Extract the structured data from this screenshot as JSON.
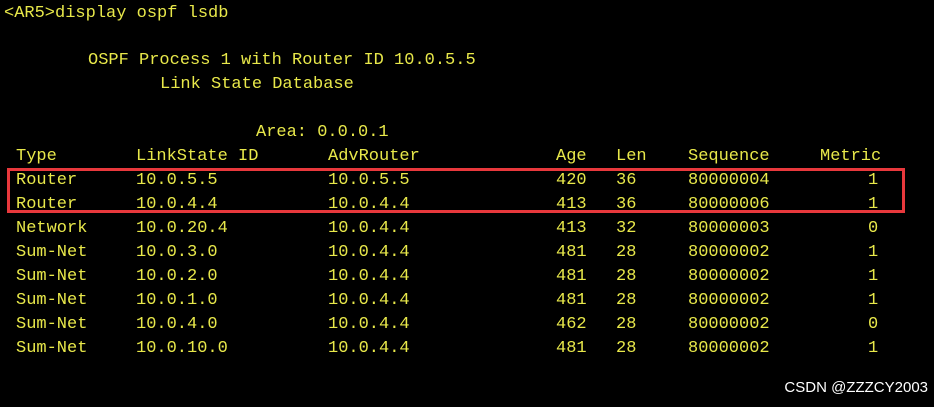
{
  "terminal": {
    "command_line": "<AR5>display ospf lsdb",
    "process_line": "OSPF Process 1 with Router ID 10.0.5.5",
    "database_title": "Link State Database",
    "area_line": "Area: 0.0.0.1",
    "columns": {
      "type": "Type",
      "linkstate_id": "LinkState ID",
      "adv_router": "AdvRouter",
      "age": "Age",
      "len": "Len",
      "sequence": "Sequence",
      "metric": "Metric"
    },
    "rows": [
      {
        "type": "Router",
        "linkstate_id": "10.0.5.5",
        "adv_router": "10.0.5.5",
        "age": "420",
        "len": "36",
        "sequence": "80000004",
        "metric": "1"
      },
      {
        "type": "Router",
        "linkstate_id": "10.0.4.4",
        "adv_router": "10.0.4.4",
        "age": "413",
        "len": "36",
        "sequence": "80000006",
        "metric": "1"
      },
      {
        "type": "Network",
        "linkstate_id": "10.0.20.4",
        "adv_router": "10.0.4.4",
        "age": "413",
        "len": "32",
        "sequence": "80000003",
        "metric": "0"
      },
      {
        "type": "Sum-Net",
        "linkstate_id": "10.0.3.0",
        "adv_router": "10.0.4.4",
        "age": "481",
        "len": "28",
        "sequence": "80000002",
        "metric": "1"
      },
      {
        "type": "Sum-Net",
        "linkstate_id": "10.0.2.0",
        "adv_router": "10.0.4.4",
        "age": "481",
        "len": "28",
        "sequence": "80000002",
        "metric": "1"
      },
      {
        "type": "Sum-Net",
        "linkstate_id": "10.0.1.0",
        "adv_router": "10.0.4.4",
        "age": "481",
        "len": "28",
        "sequence": "80000002",
        "metric": "1"
      },
      {
        "type": "Sum-Net",
        "linkstate_id": "10.0.4.0",
        "adv_router": "10.0.4.4",
        "age": "462",
        "len": "28",
        "sequence": "80000002",
        "metric": "0"
      },
      {
        "type": "Sum-Net",
        "linkstate_id": "10.0.10.0",
        "adv_router": "10.0.4.4",
        "age": "481",
        "len": "28",
        "sequence": "80000002",
        "metric": "1"
      }
    ]
  },
  "watermark": "CSDN @ZZZCY2003",
  "colors": {
    "background": "#000000",
    "terminal_text": "#e8e84a",
    "highlight_box": "#e8383c",
    "watermark": "#ffffff"
  }
}
